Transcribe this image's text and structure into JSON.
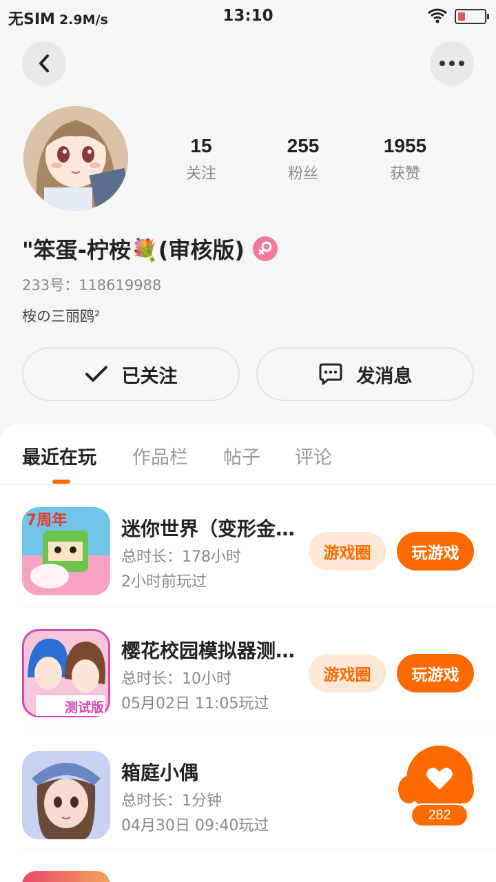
{
  "status_bar": {
    "carrier": "无SIM",
    "speed": "2.9M/s",
    "time": "13:10"
  },
  "profile": {
    "stats": [
      {
        "num": "15",
        "label": "关注"
      },
      {
        "num": "255",
        "label": "粉丝"
      },
      {
        "num": "1955",
        "label": "获赞"
      }
    ],
    "username": "\"笨蛋-柠桉💐(审核版)",
    "user_id": "233号：118619988",
    "bio": "桉の三丽鸥²",
    "follow_label": "已关注",
    "message_label": "发消息"
  },
  "tabs": [
    "最近在玩",
    "作品栏",
    "帖子",
    "评论"
  ],
  "games": [
    {
      "name": "迷你世界（变形金…",
      "time": "总时长：178小时",
      "last": "2小时前玩过",
      "circle": "游戏圈",
      "play": "玩游戏"
    },
    {
      "name": "樱花校园模拟器测…",
      "time": "总时长：10小时",
      "last": "05月02日 11:05玩过",
      "circle": "游戏圈",
      "play": "玩游戏"
    },
    {
      "name": "箱庭小偶",
      "time": "总时长：1分钟",
      "last": "04月30日 09:40玩过"
    }
  ],
  "like_count": "282",
  "colors": {
    "accent": "#ff6a00",
    "accent_light": "#fde9d6",
    "gender": "#f47a9b"
  }
}
